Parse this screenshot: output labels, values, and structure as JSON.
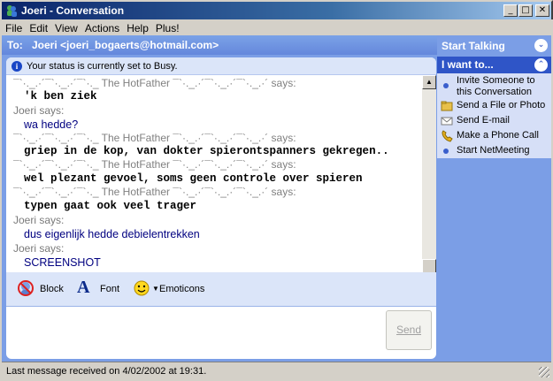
{
  "window": {
    "title": "Joeri - Conversation"
  },
  "menu": [
    "File",
    "Edit",
    "View",
    "Actions",
    "Help",
    "Plus!"
  ],
  "to": {
    "label": "To:",
    "value": "Joeri <joeri_bogaerts@hotmail.com>"
  },
  "status_notice": "Your status is currently set to Busy.",
  "conversation": [
    {
      "type": "said",
      "text": "¯`·._.·´¯`·._.·´¯`·._ The HotFather ¯`·._.·´¯`·._.·´¯`·._.·´ says:"
    },
    {
      "type": "mono",
      "text": "'k ben ziek"
    },
    {
      "type": "joeri",
      "text": "Joeri says:"
    },
    {
      "type": "blue",
      "text": "wa hedde?"
    },
    {
      "type": "said",
      "text": "¯`·._.·´¯`·._.·´¯`·._ The HotFather ¯`·._.·´¯`·._.·´¯`·._.·´ says:"
    },
    {
      "type": "mono",
      "text": "griep in de kop, van dokter spierontspanners gekregen.."
    },
    {
      "type": "said",
      "text": "¯`·._.·´¯`·._.·´¯`·._ The HotFather ¯`·._.·´¯`·._.·´¯`·._.·´ says:"
    },
    {
      "type": "mono",
      "text": "wel plezant gevoel, soms geen controle over spieren"
    },
    {
      "type": "said",
      "text": "¯`·._.·´¯`·._.·´¯`·._ The HotFather ¯`·._.·´¯`·._.·´¯`·._.·´ says:"
    },
    {
      "type": "mono",
      "text": "typen gaat ook veel trager"
    },
    {
      "type": "joeri",
      "text": "Joeri says:"
    },
    {
      "type": "blue",
      "text": "dus eigenlijk hedde debielentrekken"
    },
    {
      "type": "joeri",
      "text": "Joeri says:"
    },
    {
      "type": "blue",
      "text": "SCREENSHOT"
    }
  ],
  "toolbar": {
    "block": "Block",
    "font": "Font",
    "emoticons": "Emoticons"
  },
  "input": {
    "send_label": "Send"
  },
  "sidebar": {
    "start_talking": "Start Talking",
    "i_want_to": "I want to...",
    "items": [
      {
        "label": "Invite Someone to this Conversation",
        "icon": "bullet-icon"
      },
      {
        "label": "Send a File or Photo",
        "icon": "folder-icon"
      },
      {
        "label": "Send E-mail",
        "icon": "envelope-icon"
      },
      {
        "label": "Make a Phone Call",
        "icon": "phone-icon"
      },
      {
        "label": "Start NetMeeting",
        "icon": "bullet-icon"
      }
    ]
  },
  "status_bar": "Last message received on 4/02/2002 at 19:31."
}
